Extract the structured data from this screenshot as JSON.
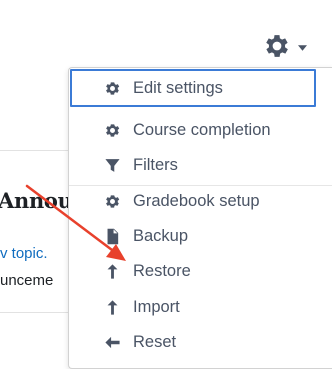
{
  "background": {
    "heading_fragment": "Annou",
    "link_fragment": "v topic.",
    "text_fragment": "unceme"
  },
  "trigger": {
    "icon": "gear-icon",
    "caret_icon": "caret-down-icon"
  },
  "menu": {
    "items": [
      {
        "label": "Edit settings",
        "icon": "gear-icon"
      },
      {
        "label": "Course completion",
        "icon": "gear-icon"
      },
      {
        "label": "Filters",
        "icon": "filter-icon"
      },
      {
        "label": "Gradebook setup",
        "icon": "gear-icon"
      },
      {
        "label": "Backup",
        "icon": "file-icon"
      },
      {
        "label": "Restore",
        "icon": "arrow-up-icon"
      },
      {
        "label": "Import",
        "icon": "arrow-up-icon"
      },
      {
        "label": "Reset",
        "icon": "arrow-left-icon"
      }
    ]
  },
  "colors": {
    "focus_border": "#3b7bd6",
    "menu_text": "#4a5465",
    "annotation_arrow": "#e8412c",
    "link": "#0f6cbf"
  }
}
